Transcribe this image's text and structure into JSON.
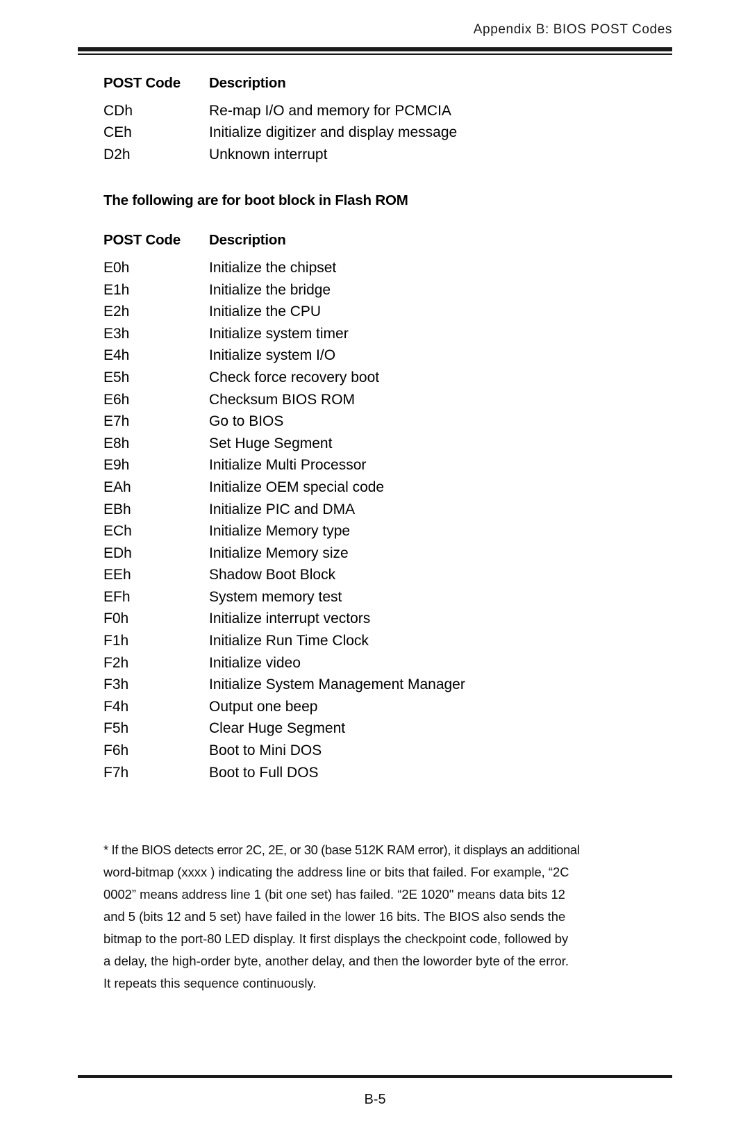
{
  "header": {
    "title": "Appendix B: BIOS POST Codes"
  },
  "table_headers": {
    "code": "POST Code",
    "description": "Description"
  },
  "first_table": {
    "rows": [
      {
        "code": "CDh",
        "description": "Re-map I/O and memory for PCMCIA"
      },
      {
        "code": "CEh",
        "description": "Initialize digitizer and display message"
      },
      {
        "code": "D2h",
        "description": "Unknown interrupt"
      }
    ]
  },
  "section_heading": "The following are for boot block in Flash ROM",
  "second_table": {
    "rows": [
      {
        "code": "E0h",
        "description": "Initialize the chipset"
      },
      {
        "code": "E1h",
        "description": "Initialize the bridge"
      },
      {
        "code": "E2h",
        "description": "Initialize the CPU"
      },
      {
        "code": "E3h",
        "description": "Initialize system timer"
      },
      {
        "code": "E4h",
        "description": "Initialize system I/O"
      },
      {
        "code": "E5h",
        "description": "Check force recovery boot"
      },
      {
        "code": "E6h",
        "description": "Checksum BIOS ROM"
      },
      {
        "code": "E7h",
        "description": "Go to BIOS"
      },
      {
        "code": "E8h",
        "description": "Set Huge Segment"
      },
      {
        "code": "E9h",
        "description": "Initialize Multi Processor"
      },
      {
        "code": "EAh",
        "description": "Initialize OEM special code"
      },
      {
        "code": "EBh",
        "description": "Initialize PIC and DMA"
      },
      {
        "code": "ECh",
        "description": "Initialize Memory type"
      },
      {
        "code": "EDh",
        "description": "Initialize Memory size"
      },
      {
        "code": "EEh",
        "description": "Shadow Boot Block"
      },
      {
        "code": "EFh",
        "description": "System memory test"
      },
      {
        "code": "F0h",
        "description": "Initialize interrupt vectors"
      },
      {
        "code": "F1h",
        "description": "Initialize Run Time Clock"
      },
      {
        "code": "F2h",
        "description": "Initialize video"
      },
      {
        "code": "F3h",
        "description": "Initialize System Management Manager"
      },
      {
        "code": "F4h",
        "description": "Output one beep"
      },
      {
        "code": "F5h",
        "description": "Clear Huge Segment"
      },
      {
        "code": "F6h",
        "description": "Boot to Mini DOS"
      },
      {
        "code": "F7h",
        "description": "Boot to Full DOS"
      }
    ]
  },
  "footnote": {
    "lines": [
      "* If the BIOS detects error 2C, 2E, or 30 (base 512K RAM error), it displays an additional",
      "word-bitmap (xxxx ) indicating the address line or bits that failed.  For example, “2C",
      "0002” means address line 1 (bit one set) has failed.  “2E 1020\" means data bits 12",
      "and 5 (bits 12 and 5 set) have failed in the lower 16 bits.  The BIOS also sends the",
      "bitmap to the port-80 LED display.  It first displays the checkpoint code, followed by",
      "a delay, the high-order byte, another delay, and then the loworder byte of the error.",
      "It repeats this sequence continuously."
    ]
  },
  "footer": {
    "page_number": "B-5"
  }
}
